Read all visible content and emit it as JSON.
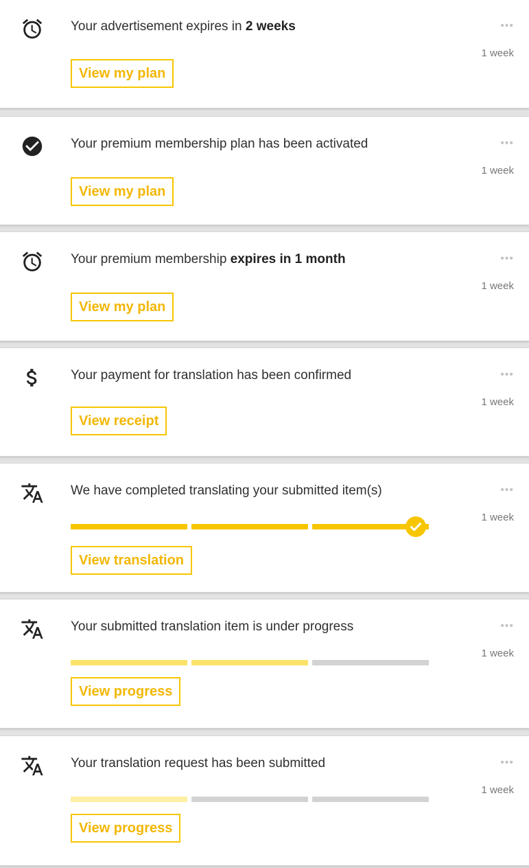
{
  "colors": {
    "accent": "#f7c600",
    "accent_text": "#f2b705",
    "segment_done": "#f7c600",
    "segment_progress": "#fbe36b",
    "segment_submitted": "#fdeea3",
    "segment_pending": "#d3d3d3"
  },
  "notifications": [
    {
      "icon": "alarm-clock-icon",
      "message_parts": [
        {
          "text": "Your advertisement expires in "
        },
        {
          "text": "2 weeks",
          "bold": true
        }
      ],
      "time": "1 week",
      "more": "•••",
      "button": "View my plan"
    },
    {
      "icon": "check-circle-icon",
      "message_parts": [
        {
          "text": "Your premium membership plan has been activated"
        }
      ],
      "time": "1 week",
      "more": "•••",
      "button": "View my plan"
    },
    {
      "icon": "alarm-clock-icon",
      "message_parts": [
        {
          "text": "Your premium membership "
        },
        {
          "text": "expires in 1 month",
          "bold": true
        }
      ],
      "time": "1 week",
      "more": "•••",
      "button": "View my plan"
    },
    {
      "icon": "dollar-icon",
      "message_parts": [
        {
          "text": "Your payment for translation has been confirmed"
        }
      ],
      "time": "1 week",
      "more": "•••",
      "button": "View receipt"
    },
    {
      "icon": "translate-icon",
      "message_parts": [
        {
          "text": "We have completed translating your submitted item(s)"
        }
      ],
      "time": "1 week",
      "more": "•••",
      "button": "View translation",
      "progress": {
        "segments": [
          "done",
          "done",
          "done"
        ],
        "completed": true
      }
    },
    {
      "icon": "translate-icon",
      "message_parts": [
        {
          "text": "Your submitted translation item is under progress"
        }
      ],
      "time": "1 week",
      "more": "•••",
      "button": "View progress",
      "progress": {
        "segments": [
          "progress",
          "progress",
          "pending"
        ],
        "completed": false
      }
    },
    {
      "icon": "translate-icon",
      "message_parts": [
        {
          "text": "Your translation request has been submitted"
        }
      ],
      "time": "1 week",
      "more": "•••",
      "button": "View progress",
      "progress": {
        "segments": [
          "submitted",
          "pending",
          "pending"
        ],
        "completed": false
      }
    }
  ]
}
